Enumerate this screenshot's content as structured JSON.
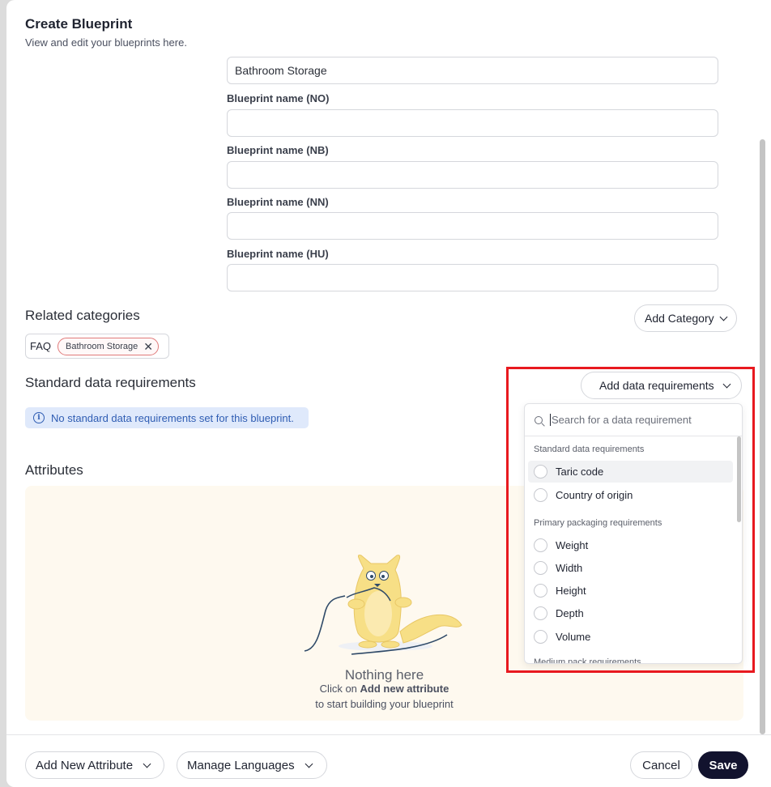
{
  "header": {
    "title": "Create Blueprint",
    "subtitle": "View and edit your blueprints here."
  },
  "fields": {
    "top_value": "Bathroom Storage",
    "items": [
      {
        "label": "Blueprint name (NO)",
        "value": ""
      },
      {
        "label": "Blueprint name (NB)",
        "value": ""
      },
      {
        "label": "Blueprint name (NN)",
        "value": ""
      },
      {
        "label": "Blueprint name (HU)",
        "value": ""
      }
    ]
  },
  "related_categories": {
    "title": "Related categories",
    "add_label": "Add Category",
    "group_label": "FAQ",
    "chips": [
      "Bathroom Storage"
    ]
  },
  "standard_data": {
    "title": "Standard data requirements",
    "add_label": "Add data requirements",
    "empty_message": "No standard data requirements set for this blueprint."
  },
  "attributes": {
    "title": "Attributes",
    "empty_title": "Nothing here",
    "empty_prefix": "Click on ",
    "empty_link": "Add new attribute",
    "empty_suffix": "to start building your blueprint"
  },
  "dropdown": {
    "search_placeholder": "Search for a data requirement",
    "groups": [
      {
        "title": "Standard data requirements",
        "items": [
          "Taric code",
          "Country of origin"
        ]
      },
      {
        "title": "Primary packaging requirements",
        "items": [
          "Weight",
          "Width",
          "Height",
          "Depth",
          "Volume"
        ]
      }
    ],
    "partial_next_group": "Medium pack requirements"
  },
  "footer": {
    "add_attribute": "Add New Attribute",
    "manage_languages": "Manage Languages",
    "cancel": "Cancel",
    "save": "Save"
  },
  "colors": {
    "highlight_frame": "#e8191f",
    "primary_button": "#12132e",
    "info_background": "#dfe9fb",
    "empty_state_background": "#fef9ef"
  },
  "icons": [
    "chevron-down-icon",
    "close-icon",
    "info-icon",
    "search-icon",
    "cat-illustration"
  ]
}
